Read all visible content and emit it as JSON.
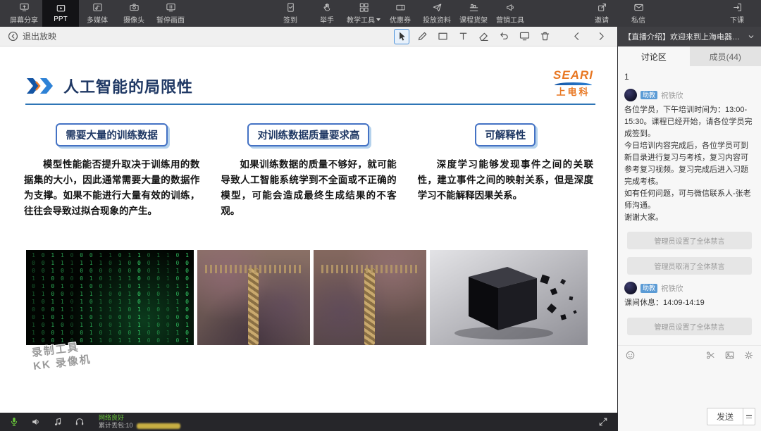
{
  "top_toolbar": {
    "screen_share": "屏幕分享",
    "ppt": "PPT",
    "multimedia": "多媒体",
    "camera": "摄像头",
    "pause_screen": "暂停画面",
    "sign_in": "签到",
    "raise_hand": "举手",
    "teaching_tools": "教学工具",
    "coupon": "优惠券",
    "materials": "投放资料",
    "course_shelf": "课程货架",
    "marketing_tools": "营销工具",
    "invite": "邀请",
    "private_message": "私信",
    "end_class": "下课"
  },
  "pres_bar": {
    "exit": "退出放映"
  },
  "slide": {
    "title": "人工智能的局限性",
    "logo_main": "SEARI",
    "logo_sub": "上电科",
    "columns": [
      {
        "heading": "需要大量的训练数据",
        "body": "模型性能能否提升取决于训练用的数据集的大小，因此通常需要大量的数据作为支撑。如果不能进行大量有效的训练，往往会导致过拟合现象的产生。"
      },
      {
        "heading": "对训练数据质量要求高",
        "body": "如果训练数据的质量不够好，就可能导致人工智能系统学到不全面或不正确的模型，可能会造成最终生成结果的不客观。"
      },
      {
        "heading": "可解释性",
        "body": "深度学习能够发现事件之间的关联性，建立事件之间的映射关系，但是深度学习不能解释因果关系。"
      }
    ],
    "watermark_line1": "录制工具",
    "watermark_line2": "KK 录像机"
  },
  "sidebar": {
    "header_title": "【直播介绍】欢迎来到上海电器…",
    "tabs": {
      "discussion": "讨论区",
      "members": "成员(44)"
    },
    "messages": [
      {
        "text": "1"
      },
      {
        "badge": "助教",
        "name": "祝铁欣",
        "text": "各位学员，下午培训时间为：13:00-15:30。课程已经开始，请各位学员完成签到。\n今日培训内容完成后，各位学员可到新目录进行复习与考核，复习内容可参考复习视频。复习完成后进入习题完成考核。\n如有任何问题，可与微信联系人-张老师沟通。\n谢谢大家。"
      },
      {
        "text": "管理员设置了全体禁言"
      },
      {
        "text": "管理员取消了全体禁言"
      },
      {
        "badge": "助教",
        "name": "祝铁欣",
        "text": "课间休息：14:09-14:19"
      },
      {
        "text": "管理员设置了全体禁言"
      }
    ],
    "send_label": "发送"
  },
  "status_bar": {
    "network": "网络良好",
    "packet_loss": "累计丢包:10"
  }
}
